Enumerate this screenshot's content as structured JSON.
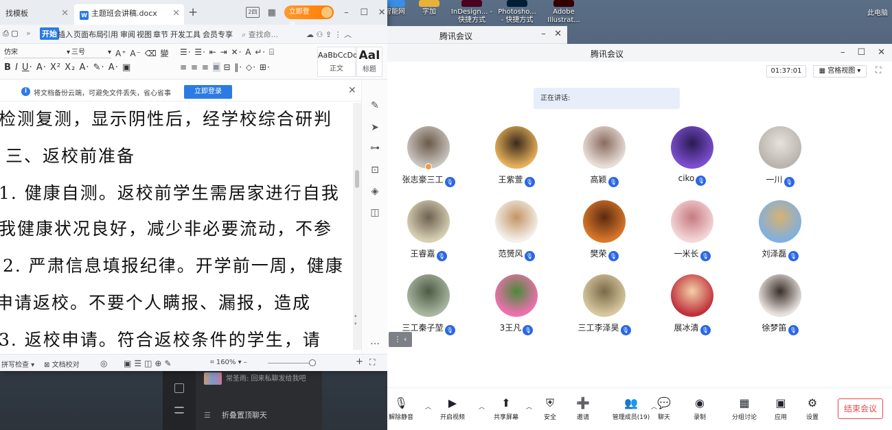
{
  "desktop": {
    "icons": [
      {
        "label": "智能网"
      },
      {
        "label": "字加"
      },
      {
        "label": "InDesign... - 快捷方式"
      },
      {
        "label": "Photosho... - 快捷方式"
      },
      {
        "label": "Adobe Illustrat..."
      }
    ],
    "this_pc": "此电脑"
  },
  "chat": {
    "message": "常圣雨: 回来私聊发给我吧",
    "fold_label": "折叠置顶聊天",
    "fold_icon": "list-icon"
  },
  "wps": {
    "tabs": [
      {
        "label": "找模板"
      },
      {
        "label": "主题班会讲稿.docx"
      }
    ],
    "doc_icon_letter": "W",
    "login_label": "立即登录",
    "layout_badge": "2四",
    "ribbon_tabs": [
      "开始",
      "插入",
      "页面布局",
      "引用",
      "审阅",
      "视图",
      "章节",
      "开发工具",
      "会员专享"
    ],
    "search_placeholder": "查找命...",
    "font_name": "仿宋",
    "font_size": "三号",
    "style_normal": {
      "preview": "AaBbCcDd",
      "caption": "正文"
    },
    "style_heading": {
      "preview": "AaI",
      "caption": "标题"
    },
    "notice": {
      "text": "将文档备份云端，可避免文件丢失，省心省事",
      "button": "立即登录"
    },
    "doc_lines": [
      "检测复测，显示阴性后，经学校综合研判",
      "三、返校前准备",
      "1. 健康自测。返校前学生需居家进行自我",
      "我健康状况良好，减少非必要流动，不参",
      "2. 严肃信息填报纪律。开学前一周，健康",
      "申请返校。不要个人瞒报、漏报，造成",
      "3. 返校申请。符合返校条件的学生，请"
    ],
    "status": {
      "spell": "拼写检查",
      "proof": "文档校对",
      "zoom": "160%"
    }
  },
  "meeting_mini": {
    "title": "腾讯会议"
  },
  "meeting": {
    "title": "腾讯会议",
    "timer": "01:37:01",
    "view_label": "宫格视图",
    "speaking_label": "正在讲话:",
    "participants": [
      {
        "name": "张志豪三工",
        "colors": [
          "#c9c4be",
          "#6b5a4a"
        ],
        "host": true
      },
      {
        "name": "王紫萱",
        "colors": [
          "#e6b05a",
          "#3a2a1c"
        ],
        "host": false
      },
      {
        "name": "高颖",
        "colors": [
          "#e9ded8",
          "#8a6c60"
        ],
        "host": false
      },
      {
        "name": "ciko",
        "colors": [
          "#7b4fd0",
          "#2b1a52"
        ],
        "host": false
      },
      {
        "name": "一川",
        "colors": [
          "#b9b4ad",
          "#e7e2db"
        ],
        "host": false
      },
      {
        "name": "王睿嘉",
        "colors": [
          "#d7cfb5",
          "#6e6250"
        ],
        "host": false
      },
      {
        "name": "范赟风",
        "colors": [
          "#f3f0ea",
          "#c49464"
        ],
        "host": false
      },
      {
        "name": "樊荣",
        "colors": [
          "#d9772a",
          "#5a2a10"
        ],
        "host": false
      },
      {
        "name": "一米长",
        "colors": [
          "#f3d6d8",
          "#c77a80"
        ],
        "host": false
      },
      {
        "name": "刘泽磊",
        "colors": [
          "#7fb0e0",
          "#d8b170"
        ],
        "host": false
      },
      {
        "name": "三工秦子堃",
        "colors": [
          "#a9b7a0",
          "#4d5b45"
        ],
        "host": false
      },
      {
        "name": "3王凡",
        "colors": [
          "#f070b0",
          "#4a8a3a"
        ],
        "host": false
      },
      {
        "name": "三工李泽昊",
        "colors": [
          "#d8c8a0",
          "#7a6a48"
        ],
        "host": false
      },
      {
        "name": "展冰清",
        "colors": [
          "#c0303a",
          "#f2d0a8"
        ],
        "host": false
      },
      {
        "name": "徐梦笛",
        "colors": [
          "#e8e2de",
          "#3a2e2a"
        ],
        "host": false
      }
    ],
    "toolbar": [
      {
        "label": "解除静音",
        "icon": "mic-off-icon",
        "glyph": "🎙"
      },
      {
        "label": "开启视频",
        "icon": "camera-off-icon",
        "glyph": "▶"
      },
      {
        "label": "共享屏幕",
        "icon": "share-screen-icon",
        "glyph": "⬆"
      },
      {
        "label": "安全",
        "icon": "shield-icon",
        "glyph": "⛨"
      },
      {
        "label": "邀请",
        "icon": "invite-icon",
        "glyph": "➕"
      },
      {
        "label": "管理成员(19)",
        "icon": "members-icon",
        "glyph": "👥"
      },
      {
        "label": "聊天",
        "icon": "chat-icon",
        "glyph": "💬"
      },
      {
        "label": "录制",
        "icon": "record-icon",
        "glyph": "◉"
      },
      {
        "label": "分组讨论",
        "icon": "breakout-icon",
        "glyph": "▦"
      },
      {
        "label": "应用",
        "icon": "apps-icon",
        "glyph": "▣"
      },
      {
        "label": "设置",
        "icon": "gear-icon",
        "glyph": "⚙"
      }
    ],
    "end_label": "结束会议"
  }
}
